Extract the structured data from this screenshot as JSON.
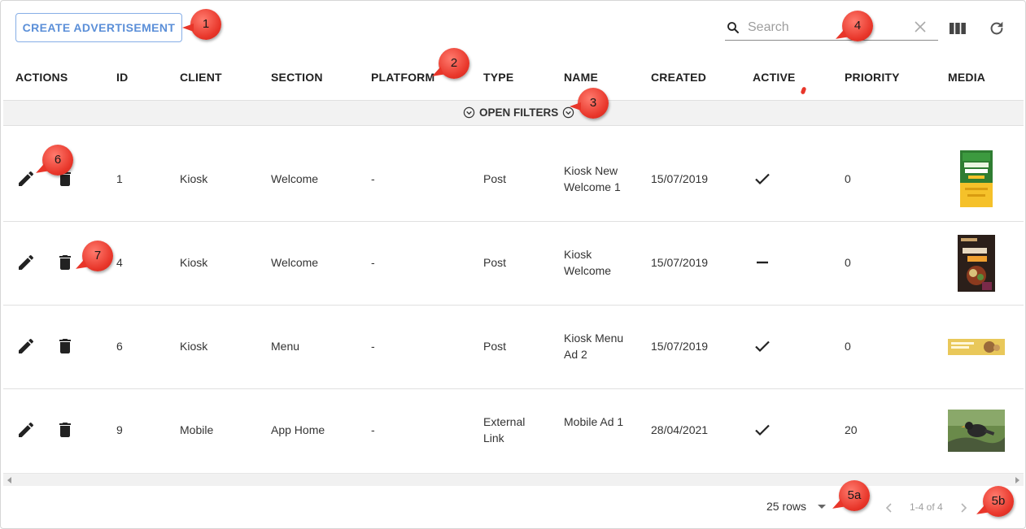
{
  "toolbar": {
    "create_label": "CREATE ADVERTISEMENT",
    "search_placeholder": "Search"
  },
  "icons": {
    "search": "search-icon",
    "clear": "close-icon",
    "columns": "view-column-icon",
    "refresh": "refresh-icon",
    "edit": "pencil-icon",
    "delete": "trash-icon",
    "active_true": "check-icon",
    "active_false": "dash-icon",
    "filters": "chevron-down-circle-icon"
  },
  "table": {
    "columns": [
      "ACTIONS",
      "ID",
      "CLIENT",
      "SECTION",
      "PLATFORM",
      "TYPE",
      "NAME",
      "CREATED",
      "ACTIVE",
      "PRIORITY",
      "MEDIA"
    ],
    "filters_label": "OPEN FILTERS",
    "rows": [
      {
        "id": "1",
        "client": "Kiosk",
        "section": "Welcome",
        "platform": "-",
        "type": "Post",
        "name": "Kiosk New Welcome 1",
        "created": "15/07/2019",
        "active": true,
        "priority": "0",
        "media": "green-yellow-poster"
      },
      {
        "id": "4",
        "client": "Kiosk",
        "section": "Welcome",
        "platform": "-",
        "type": "Post",
        "name": "Kiosk Welcome",
        "created": "15/07/2019",
        "active": false,
        "priority": "0",
        "media": "dark-food-poster"
      },
      {
        "id": "6",
        "client": "Kiosk",
        "section": "Menu",
        "platform": "-",
        "type": "Post",
        "name": "Kiosk Menu Ad 2",
        "created": "15/07/2019",
        "active": true,
        "priority": "0",
        "media": "yellow-banner"
      },
      {
        "id": "9",
        "client": "Mobile",
        "section": "App Home",
        "platform": "-",
        "type": "External Link",
        "name": "Mobile Ad 1",
        "created": "28/04/2021",
        "active": true,
        "priority": "20",
        "media": "bird-photo"
      }
    ]
  },
  "footer": {
    "rows_per_page": "25 rows",
    "range": "1-4 of 4"
  },
  "callouts": [
    "1",
    "2",
    "3",
    "4",
    "5a",
    "5b",
    "6",
    "7"
  ],
  "colors": {
    "accent": "#5b8fd8",
    "callout": "#e8362a",
    "filter_bar": "#f2f2f2"
  }
}
